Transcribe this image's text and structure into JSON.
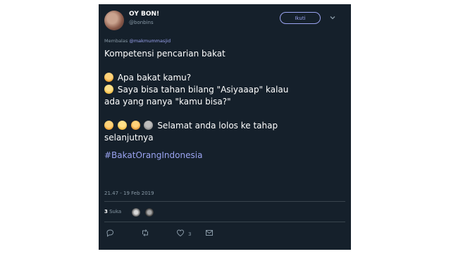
{
  "user": {
    "name": "OY BON!",
    "handle": "@bonbins"
  },
  "follow_label": "Ikuti",
  "reply_to": {
    "prefix": "Membalas",
    "mention": "@makmummasjid"
  },
  "tweet": {
    "line1": "Kompetensi pencarian bakat",
    "line2": "Apa bakat kamu?",
    "line3": "Saya bisa tahan bilang \"Asiyaaap\" kalau",
    "line4": "ada yang nanya \"kamu bisa?\"",
    "line5": "Selamat anda lolos ke tahap",
    "line6": "selanjutnya",
    "hashtag": "#BakatOrangIndonesia"
  },
  "timestamp": "21.47 - 19 Feb 2019",
  "likes": {
    "count": "3",
    "label": "Suka"
  },
  "action_like_count": "3",
  "colors": {
    "background": "#15202b",
    "accent": "#9aa3f0",
    "muted": "#8899a6",
    "divider": "#38444d"
  },
  "icons": [
    "reply-icon",
    "retweet-icon",
    "heart-icon",
    "message-icon",
    "chevron-down-icon"
  ]
}
